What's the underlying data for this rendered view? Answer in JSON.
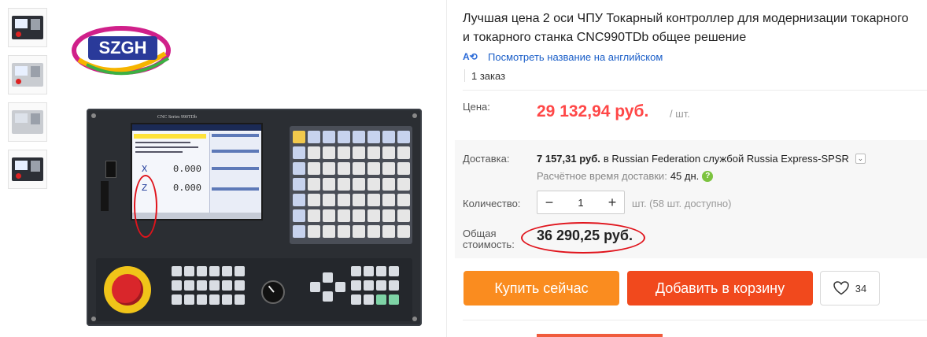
{
  "product": {
    "title": "Лучшая цена 2 оси ЧПУ Токарный контроллер для модернизации токарного и токарного станка CNC990TDb общее решение",
    "translate_icon": "translate-icon",
    "translate_link": "Посмотреть название на английском",
    "orders": "1 заказ"
  },
  "gallery": {
    "thumbnails": [
      {
        "name": "thumbnail-1",
        "style": "dark"
      },
      {
        "name": "thumbnail-2",
        "style": "light"
      },
      {
        "name": "thumbnail-3",
        "style": "light"
      },
      {
        "name": "thumbnail-4",
        "style": "dark"
      }
    ],
    "logo_text": "SZGH",
    "device": {
      "header": "CNC Series 990TDb",
      "x_axis": "X",
      "z_axis": "Z",
      "x_value": "0.000",
      "z_value": "0.000"
    }
  },
  "price": {
    "label": "Цена:",
    "value": "29 132,94 руб.",
    "unit": "/ шт."
  },
  "shipping": {
    "label": "Доставка:",
    "cost": "7 157,31 руб.",
    "middle": "в Russian Federation службой Russia Express-SPSR",
    "eta_label": "Расчётное время доставки:",
    "eta_days": "45 дн."
  },
  "quantity": {
    "label": "Количество:",
    "value": "1",
    "stock": "шт. (58 шт. доступно)"
  },
  "total": {
    "label": "Общая стоимость:",
    "value": "36 290,25 руб."
  },
  "actions": {
    "buy_now": "Купить сейчас",
    "add_to_cart": "Добавить в корзину",
    "wishlist_count": "34"
  },
  "colors": {
    "price_red": "#ff4747",
    "buy_orange": "#fa8c1f",
    "cart_red": "#f1491d",
    "link_blue": "#1a5ec8"
  }
}
